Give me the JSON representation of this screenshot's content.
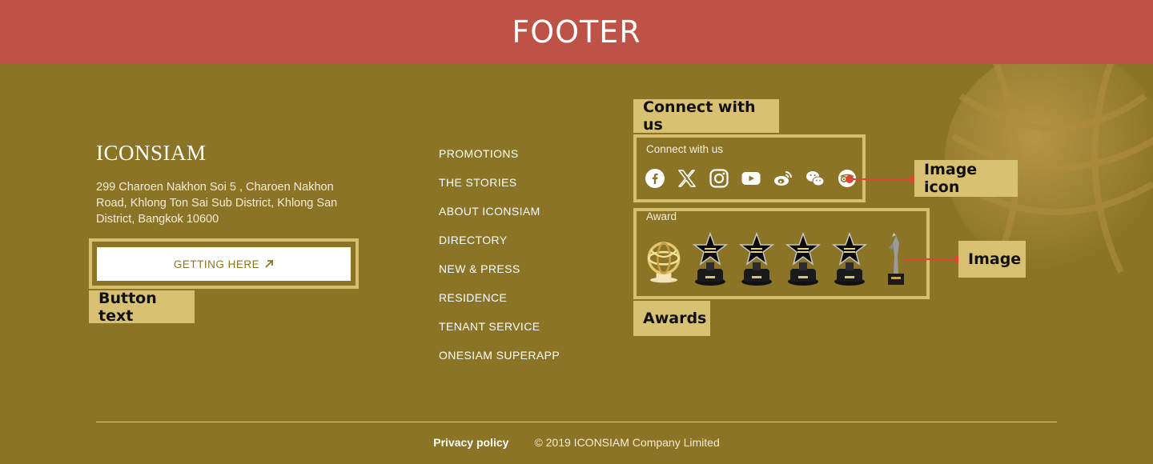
{
  "banner": {
    "title": "FOOTER"
  },
  "brand": {
    "logo_text": "ICONSIAM",
    "address": "299 Charoen Nakhon Soi 5 , Charoen Nakhon Road, Khlong Ton Sai Sub District, Khlong San District, Bangkok 10600",
    "getting_here_label": "GETTING HERE"
  },
  "nav": {
    "items": [
      {
        "label": "PROMOTIONS"
      },
      {
        "label": "THE STORIES"
      },
      {
        "label": "ABOUT ICONSIAM"
      },
      {
        "label": "DIRECTORY"
      },
      {
        "label": "NEW & PRESS"
      },
      {
        "label": "RESIDENCE"
      },
      {
        "label": "TENANT SERVICE"
      },
      {
        "label": "ONESIAM SUPERAPP"
      }
    ]
  },
  "connect": {
    "label": "Connect with us",
    "icons": [
      "facebook-icon",
      "x-icon",
      "instagram-icon",
      "youtube-icon",
      "weibo-icon",
      "wechat-icon",
      "tripadvisor-icon"
    ]
  },
  "awards": {
    "label": "Award",
    "items": [
      "globe-trophy",
      "star-trophy",
      "star-trophy",
      "star-trophy",
      "star-trophy",
      "statue-trophy"
    ]
  },
  "annotations": {
    "connect": "Connect with us",
    "image_icon": "Image icon",
    "image": "Image",
    "awards": "Awards",
    "button_text": "Button text"
  },
  "bottom": {
    "privacy_label": "Privacy policy",
    "copyright": "© 2019 ICONSIAM Company Limited"
  },
  "colors": {
    "banner": "#bf5247",
    "footer_bg": "#8b7425",
    "annotation": "#d8c172",
    "arrow": "#e24434"
  }
}
